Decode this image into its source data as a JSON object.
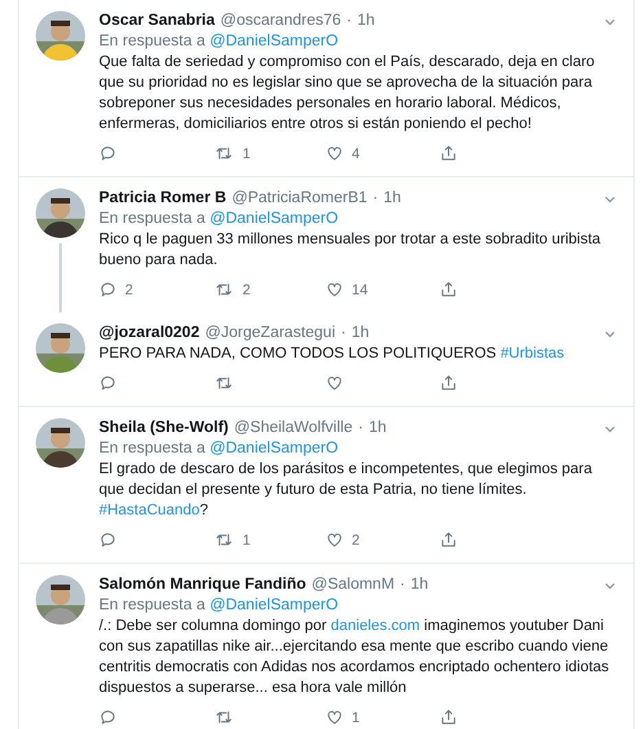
{
  "tweets": [
    {
      "name": "Oscar Sanabria",
      "handle": "@oscarandres76",
      "separator": "·",
      "time": "1h",
      "reply_label": "En respuesta a",
      "reply_to": "@DanielSamperO",
      "body": [
        {
          "kind": "text",
          "text": "Que falta de seriedad y compromiso con el País, descarado, deja en claro que su prioridad no es legislar sino que se aprovecha de la situación para sobreponer sus necesidades personales en horario laboral. Médicos, enfermeras, domiciliarios entre otros si están poniendo el pecho!"
        }
      ],
      "retweets": "1",
      "likes": "4",
      "thread_continues": false
    },
    {
      "name": "Patricia Romer B",
      "handle": "@PatriciaRomerB1",
      "separator": "·",
      "time": "1h",
      "reply_label": "En respuesta a",
      "reply_to": "@DanielSamperO",
      "body": [
        {
          "kind": "text",
          "text": "Rico q le paguen 33 millones mensuales por trotar a este sobradito uribista bueno para nada."
        }
      ],
      "replies": "2",
      "retweets": "2",
      "likes": "14",
      "thread_continues": true
    },
    {
      "name": "@jozaral0202",
      "handle": "@JorgeZarastegui",
      "separator": "·",
      "time": "1h",
      "body": [
        {
          "kind": "text",
          "text": "PERO PARA NADA, COMO TODOS LOS POLITIQUEROS "
        },
        {
          "kind": "link",
          "text": "#Urbistas"
        }
      ],
      "thread_continues": false
    },
    {
      "name": "Sheila (She-Wolf)",
      "handle": "@SheilaWolfville",
      "separator": "·",
      "time": "1h",
      "reply_label": "En respuesta a",
      "reply_to": "@DanielSamperO",
      "body": [
        {
          "kind": "text",
          "text": "El grado de descaro de los parásitos e incompetentes, que elegimos para que decidan el presente y futuro de esta Patria, no tiene límites. "
        },
        {
          "kind": "link",
          "text": "#HastaCuando"
        },
        {
          "kind": "text",
          "text": "?"
        }
      ],
      "retweets": "1",
      "likes": "2",
      "thread_continues": false
    },
    {
      "name": "Salomón Manrique Fandiño",
      "handle": "@SalomnM",
      "separator": "·",
      "time": "1h",
      "reply_label": "En respuesta a",
      "reply_to": "@DanielSamperO",
      "body": [
        {
          "kind": "text",
          "text": "/.: Debe ser columna domingo por "
        },
        {
          "kind": "link",
          "text": "danieles.com"
        },
        {
          "kind": "text",
          "text": " imaginemos youtuber Dani con sus zapatillas nike air...ejercitando esa mente que escribo cuando viene centritis democratis con Adidas nos acordamos encriptado ochentero idiotas dispuestos a superarse... esa hora vale millón"
        }
      ],
      "likes": "1",
      "thread_continues": false
    }
  ]
}
